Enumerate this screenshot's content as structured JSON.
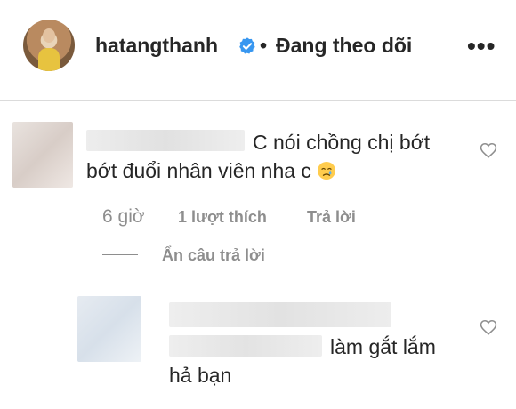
{
  "post_header": {
    "username": "hatangthanh",
    "separator": "•",
    "follow_status": "Đang theo dõi",
    "more": "•••"
  },
  "comments": [
    {
      "text_line1": "C nói chồng chị bớt",
      "text_line2": "bớt đuổi nhân viên nha c",
      "time": "6 giờ",
      "likes": "1 lượt thích",
      "reply": "Trả lời",
      "hide_replies": "Ẩn câu trả lời"
    },
    {
      "text_line1": "làm gắt lắm",
      "text_line2": "hả bạn"
    }
  ],
  "icons": {
    "verified": "verified-badge-icon",
    "heart": "heart-outline-icon",
    "emoji": "crying-face-emoji"
  },
  "colors": {
    "text": "#262626",
    "meta": "#8e8e8e",
    "verified": "#3897f0"
  }
}
